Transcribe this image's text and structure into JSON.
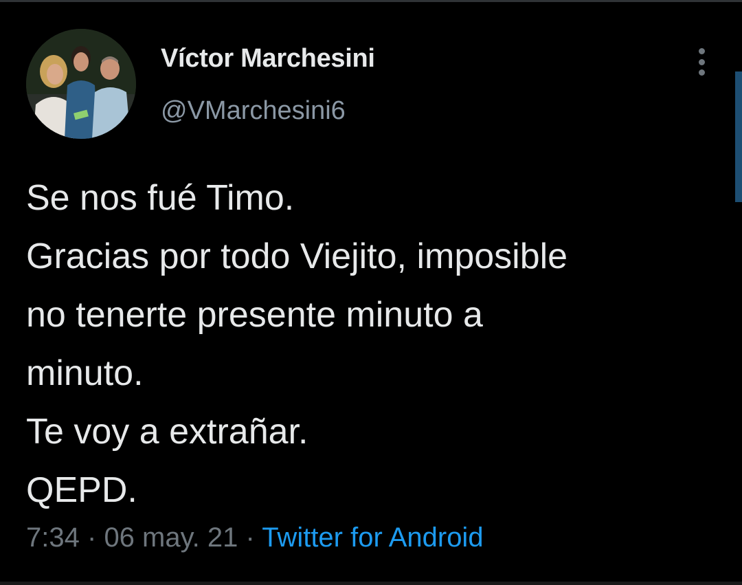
{
  "tweet": {
    "author": {
      "display_name": "Víctor Marchesini",
      "handle": "@VMarchesini6",
      "avatar_icon": "profile-photo"
    },
    "more_icon": "vertical-ellipsis-icon",
    "text_lines": [
      "Se nos fué Timo.",
      "Gracias por todo Viejito, imposible",
      "no tenerte presente minuto a",
      "minuto.",
      "Te voy a extrañar.",
      "QEPD."
    ],
    "time": "7:34",
    "date": "06 may. 21",
    "separator": "·",
    "source": "Twitter for Android"
  },
  "colors": {
    "background": "#000000",
    "primary_text": "#e7e9ea",
    "secondary_text": "#6e767d",
    "link": "#1d9bf0"
  }
}
